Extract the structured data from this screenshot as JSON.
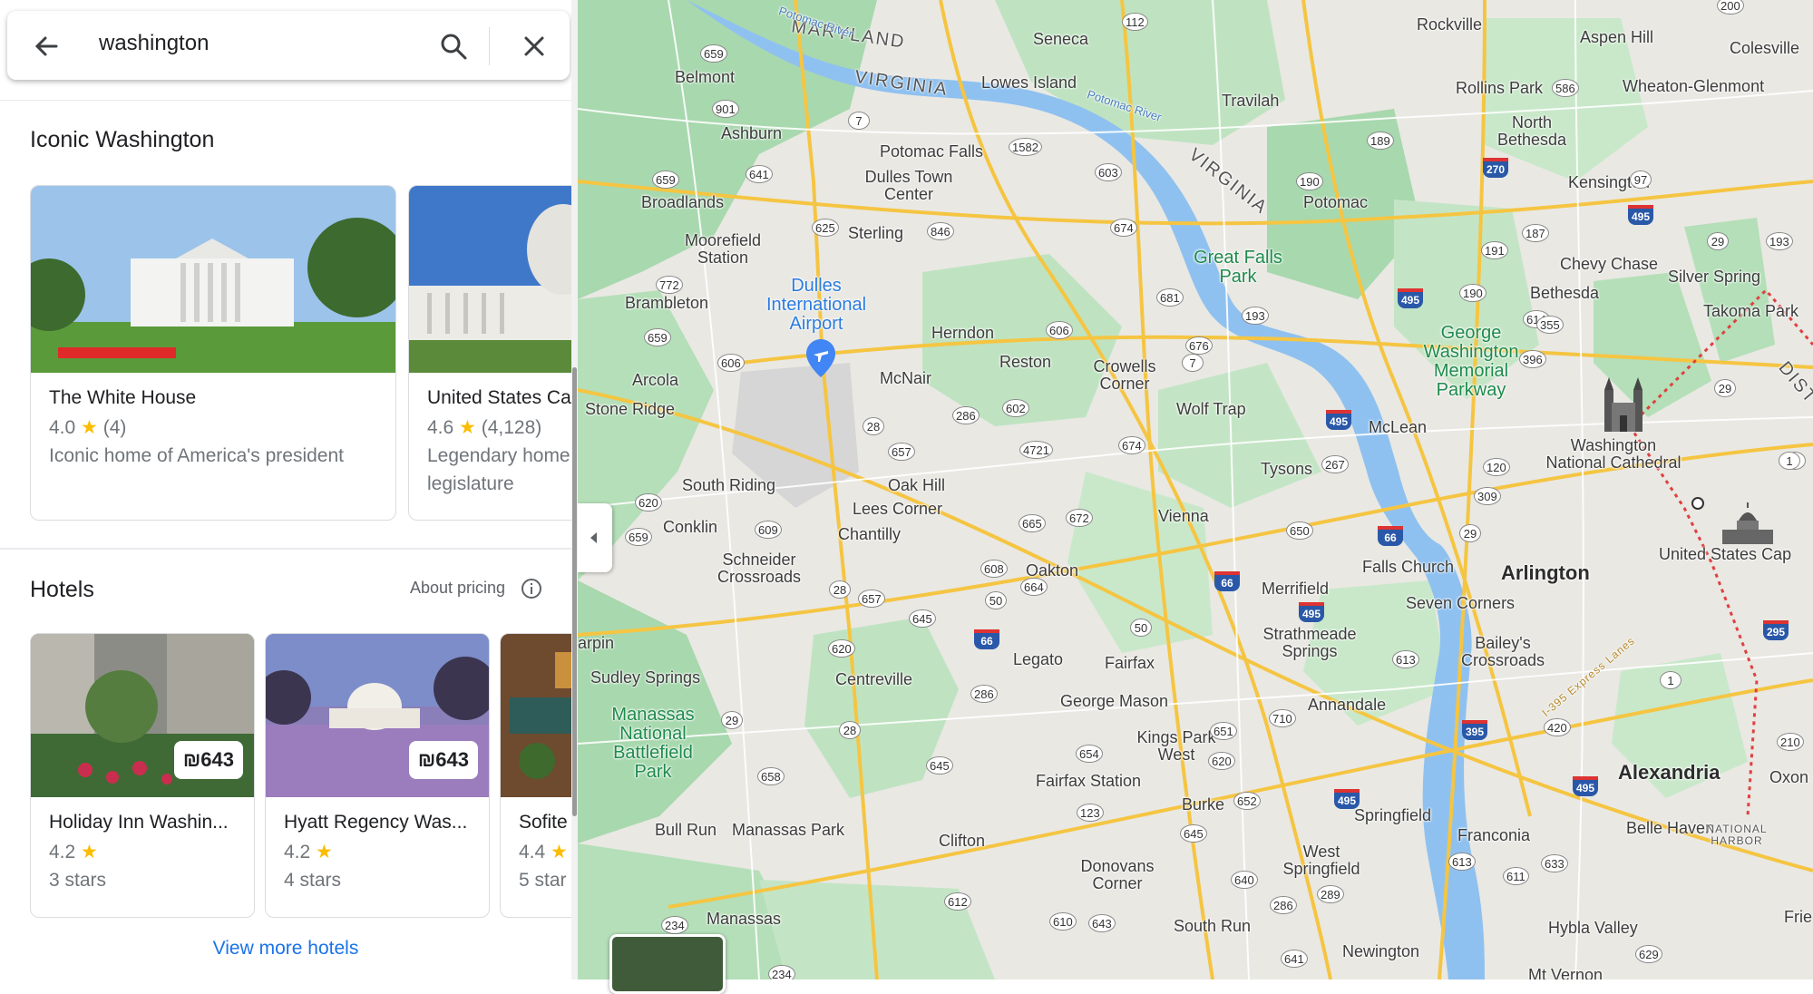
{
  "search": {
    "query": "washington",
    "back_label": "back",
    "search_label": "search",
    "close_label": "close"
  },
  "iconic": {
    "title": "Iconic Washington",
    "cards": [
      {
        "name": "The White House",
        "rating": "4.0",
        "star": "★",
        "count": "(4)",
        "desc": "Iconic home of America's president"
      },
      {
        "name": "United States Ca",
        "rating": "4.6",
        "star": "★",
        "count": "(4,128)",
        "desc": "Legendary home legislature"
      }
    ]
  },
  "hotels": {
    "title": "Hotels",
    "about_pricing": "About pricing",
    "view_more": "View more hotels",
    "items": [
      {
        "name": "Holiday Inn Washin...",
        "price": "₪643",
        "rating": "4.2",
        "star": "★",
        "stars": "3 stars"
      },
      {
        "name": "Hyatt Regency Was...",
        "price": "₪643",
        "rating": "4.2",
        "star": "★",
        "stars": "4 stars"
      },
      {
        "name": "Sofite",
        "rating": "4.4",
        "star": "★",
        "stars": "5 star"
      }
    ]
  },
  "map": {
    "labels": {
      "maryland": "MARYLAND",
      "virginia1": "VIRGINIA",
      "virginia2": "VIRGINIA",
      "potomac_river1": "Potomac River",
      "potomac_river2": "Potomac River",
      "seneca": "Seneca",
      "lowes_island": "Lowes Island",
      "travilah": "Travilah",
      "rockville": "Rockville",
      "aspen_hill": "Aspen Hill",
      "colesville": "Colesville",
      "rollins_park": "Rollins Park",
      "wheaton": "Wheaton-Glenmont",
      "north_bethesda": "North Bethesda",
      "kensington": "Kensington",
      "potomac": "Potomac",
      "chevy_chase": "Chevy Chase",
      "silver_spring": "Silver Spring",
      "bethesda": "Bethesda",
      "takoma_park": "Takoma Park",
      "belmont": "Belmont",
      "ashburn": "Ashburn",
      "potomac_falls": "Potomac Falls",
      "dulles_town_center": "Dulles Town Center",
      "broadlands": "Broadlands",
      "moorefield": "Moorefield Station",
      "sterling": "Sterling",
      "brambleton": "Brambleton",
      "dulles_airport": "Dulles International Airport",
      "herndon": "Herndon",
      "reston": "Reston",
      "crowells": "Crowells Corner",
      "great_falls": "Great Falls Park",
      "gw_parkway": "George Washington Memorial Parkway",
      "arcola": "Arcola",
      "stone_ridge": "Stone Ridge",
      "mcnair": "McNair",
      "wolf_trap": "Wolf Trap",
      "mclean": "McLean",
      "washington_cathedral": "Washington National Cathedral",
      "tysons": "Tysons",
      "south_riding": "South Riding",
      "oak_hill": "Oak Hill",
      "lees_corner": "Lees Corner",
      "chantilly": "Chantilly",
      "vienna": "Vienna",
      "conklin": "Conklin",
      "schneider": "Schneider Crossroads",
      "oakton": "Oakton",
      "falls_church": "Falls Church",
      "arlington": "Arlington",
      "us_capitol": "United States Cap",
      "merrifield": "Merrifield",
      "seven_corners": "Seven Corners",
      "arpin": "arpin",
      "sudley": "Sudley Springs",
      "centreville": "Centreville",
      "legato": "Legato",
      "strathmeade": "Strathmeade Springs",
      "fairfax": "Fairfax",
      "baileys": "Bailey's Crossroads",
      "manassas_park_bf": "Manassas National Battlefield Park",
      "george_mason": "George Mason",
      "annandale": "Annandale",
      "kings_park": "Kings Park West",
      "alexandria": "Alexandria",
      "oxon": "Oxon H",
      "fairfax_station": "Fairfax Station",
      "burke": "Burke",
      "springfield": "Springfield",
      "franconia": "Franconia",
      "belle_haven": "Belle Haven",
      "national_harbor": "NATIONAL HARBOR",
      "bull_run": "Bull Run",
      "manassas_park": "Manassas Park",
      "clifton": "Clifton",
      "donovans": "Donovans Corner",
      "west_springfield": "West Springfield",
      "manassas": "Manassas",
      "south_run": "South Run",
      "hybla_valley": "Hybla Valley",
      "newington": "Newington",
      "mt_vernon": "Mt Vernon",
      "frie": "Frie",
      "express_lanes": "I-395 Express Lanes",
      "dist": "DIST"
    },
    "shields": [
      "112",
      "200",
      "659",
      "901",
      "7",
      "1582",
      "603",
      "189",
      "190",
      "641",
      "659",
      "625",
      "846",
      "674",
      "772",
      "659",
      "606",
      "681",
      "193",
      "676",
      "606",
      "7",
      "286",
      "602",
      "28",
      "657",
      "4721",
      "674",
      "267",
      "120",
      "309",
      "620",
      "609",
      "665",
      "672",
      "650",
      "29",
      "659",
      "608",
      "50",
      "664",
      "28",
      "657",
      "645",
      "620",
      "50",
      "613",
      "29",
      "710",
      "651",
      "620",
      "654",
      "652",
      "645",
      "123",
      "640",
      "289",
      "286",
      "612",
      "610",
      "643",
      "641",
      "234",
      "234",
      "586",
      "187",
      "191",
      "190",
      "614",
      "355",
      "396",
      "29",
      "193",
      "97",
      "29",
      "1",
      "1",
      "420",
      "210",
      "633",
      "611",
      "629",
      "613",
      "658",
      "645",
      "28",
      "286",
      "1"
    ],
    "interstates": [
      "270",
      "495",
      "495",
      "495",
      "66",
      "66",
      "495",
      "66",
      "395",
      "495",
      "495",
      "295"
    ]
  }
}
